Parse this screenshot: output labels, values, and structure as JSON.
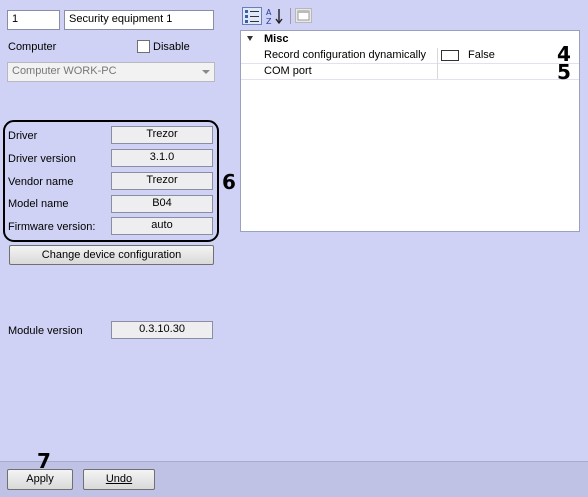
{
  "device": {
    "number": "1",
    "name": "Security equipment 1"
  },
  "computer": {
    "label": "Computer",
    "disable_label": "Disable",
    "value": "Computer WORK-PC"
  },
  "driver_info": [
    {
      "label": "Driver",
      "value": "Trezor"
    },
    {
      "label": "Driver version",
      "value": "3.1.0"
    },
    {
      "label": "Vendor name",
      "value": "Trezor"
    },
    {
      "label": "Model name",
      "value": "B04"
    },
    {
      "label": "Firmware version:",
      "value": "auto"
    }
  ],
  "change_config_label": "Change device configuration",
  "module_version": {
    "label": "Module version",
    "value": "0.3.10.30"
  },
  "property_grid": {
    "category": "Misc",
    "rows": [
      {
        "name": "Record configuration dynamically",
        "value": "False"
      },
      {
        "name": "COM port",
        "value": ""
      }
    ]
  },
  "callouts": {
    "c4": "4",
    "c5": "5",
    "c6": "6",
    "c7": "7"
  },
  "footer": {
    "apply_label": "Apply",
    "undo_label": "Undo"
  }
}
